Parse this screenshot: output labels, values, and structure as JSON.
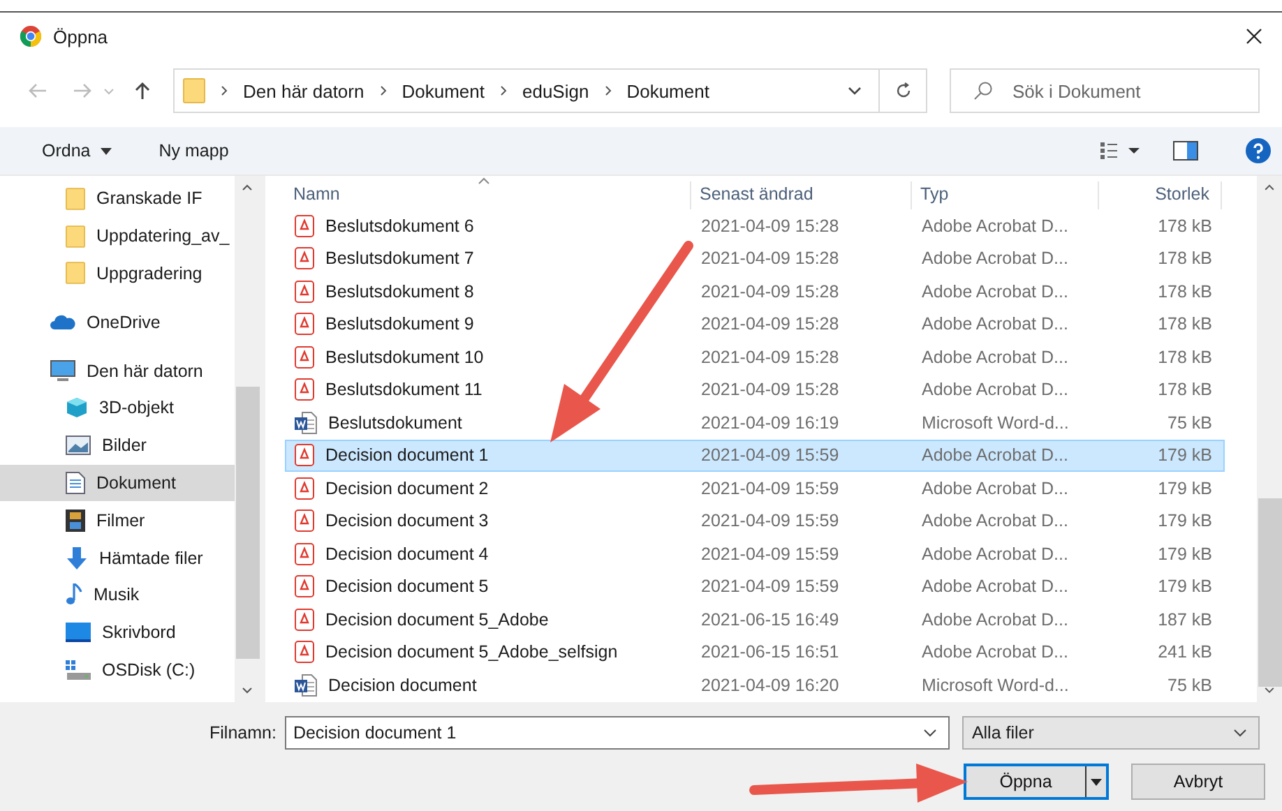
{
  "window": {
    "title": "Öppna"
  },
  "address": {
    "crumbs": [
      "Den här datorn",
      "Dokument",
      "eduSign",
      "Dokument"
    ]
  },
  "search": {
    "placeholder": "Sök i Dokument"
  },
  "toolbar": {
    "organize": "Ordna",
    "new_folder": "Ny mapp"
  },
  "sidebar": {
    "items": [
      {
        "label": "Granskade IF",
        "kind": "folder",
        "selected": false
      },
      {
        "label": "Uppdatering_av_",
        "kind": "folder",
        "selected": false
      },
      {
        "label": "Uppgradering",
        "kind": "folder",
        "selected": false
      },
      {
        "label": "OneDrive",
        "kind": "cloud",
        "selected": false
      },
      {
        "label": "Den här datorn",
        "kind": "pc",
        "selected": false,
        "children": [
          {
            "label": "3D-objekt",
            "kind": "cube",
            "selected": false
          },
          {
            "label": "Bilder",
            "kind": "picture",
            "selected": false
          },
          {
            "label": "Dokument",
            "kind": "document",
            "selected": true
          },
          {
            "label": "Filmer",
            "kind": "film",
            "selected": false
          },
          {
            "label": "Hämtade filer",
            "kind": "download",
            "selected": false
          },
          {
            "label": "Musik",
            "kind": "music",
            "selected": false
          },
          {
            "label": "Skrivbord",
            "kind": "desktop",
            "selected": false
          },
          {
            "label": "OSDisk (C:)",
            "kind": "disk",
            "selected": false
          }
        ]
      }
    ]
  },
  "table": {
    "columns": [
      "Namn",
      "Senast ändrad",
      "Typ",
      "Storlek"
    ],
    "rows": [
      {
        "name": "Beslutsdokument 6",
        "modified": "2021-04-09 15:28",
        "type": "Adobe Acrobat D...",
        "size": "178 kB",
        "kind": "pdf",
        "selected": false
      },
      {
        "name": "Beslutsdokument 7",
        "modified": "2021-04-09 15:28",
        "type": "Adobe Acrobat D...",
        "size": "178 kB",
        "kind": "pdf",
        "selected": false
      },
      {
        "name": "Beslutsdokument 8",
        "modified": "2021-04-09 15:28",
        "type": "Adobe Acrobat D...",
        "size": "178 kB",
        "kind": "pdf",
        "selected": false
      },
      {
        "name": "Beslutsdokument 9",
        "modified": "2021-04-09 15:28",
        "type": "Adobe Acrobat D...",
        "size": "178 kB",
        "kind": "pdf",
        "selected": false
      },
      {
        "name": "Beslutsdokument 10",
        "modified": "2021-04-09 15:28",
        "type": "Adobe Acrobat D...",
        "size": "178 kB",
        "kind": "pdf",
        "selected": false
      },
      {
        "name": "Beslutsdokument 11",
        "modified": "2021-04-09 15:28",
        "type": "Adobe Acrobat D...",
        "size": "178 kB",
        "kind": "pdf",
        "selected": false
      },
      {
        "name": "Beslutsdokument",
        "modified": "2021-04-09 16:19",
        "type": "Microsoft Word-d...",
        "size": "75 kB",
        "kind": "word",
        "selected": false
      },
      {
        "name": "Decision document 1",
        "modified": "2021-04-09 15:59",
        "type": "Adobe Acrobat D...",
        "size": "179 kB",
        "kind": "pdf",
        "selected": true
      },
      {
        "name": "Decision document 2",
        "modified": "2021-04-09 15:59",
        "type": "Adobe Acrobat D...",
        "size": "179 kB",
        "kind": "pdf",
        "selected": false
      },
      {
        "name": "Decision document 3",
        "modified": "2021-04-09 15:59",
        "type": "Adobe Acrobat D...",
        "size": "179 kB",
        "kind": "pdf",
        "selected": false
      },
      {
        "name": "Decision document 4",
        "modified": "2021-04-09 15:59",
        "type": "Adobe Acrobat D...",
        "size": "179 kB",
        "kind": "pdf",
        "selected": false
      },
      {
        "name": "Decision document 5",
        "modified": "2021-04-09 15:59",
        "type": "Adobe Acrobat D...",
        "size": "179 kB",
        "kind": "pdf",
        "selected": false
      },
      {
        "name": "Decision document 5_Adobe",
        "modified": "2021-06-15 16:49",
        "type": "Adobe Acrobat D...",
        "size": "187 kB",
        "kind": "pdf",
        "selected": false
      },
      {
        "name": "Decision document 5_Adobe_selfsign",
        "modified": "2021-06-15 16:51",
        "type": "Adobe Acrobat D...",
        "size": "241 kB",
        "kind": "pdf",
        "selected": false
      },
      {
        "name": "Decision document",
        "modified": "2021-04-09 16:20",
        "type": "Microsoft Word-d...",
        "size": "75 kB",
        "kind": "word",
        "selected": false
      }
    ]
  },
  "filename": {
    "label": "Filnamn:",
    "value": "Decision document 1"
  },
  "filter": {
    "value": "Alla filer"
  },
  "buttons": {
    "open": "Öppna",
    "cancel": "Avbryt"
  }
}
